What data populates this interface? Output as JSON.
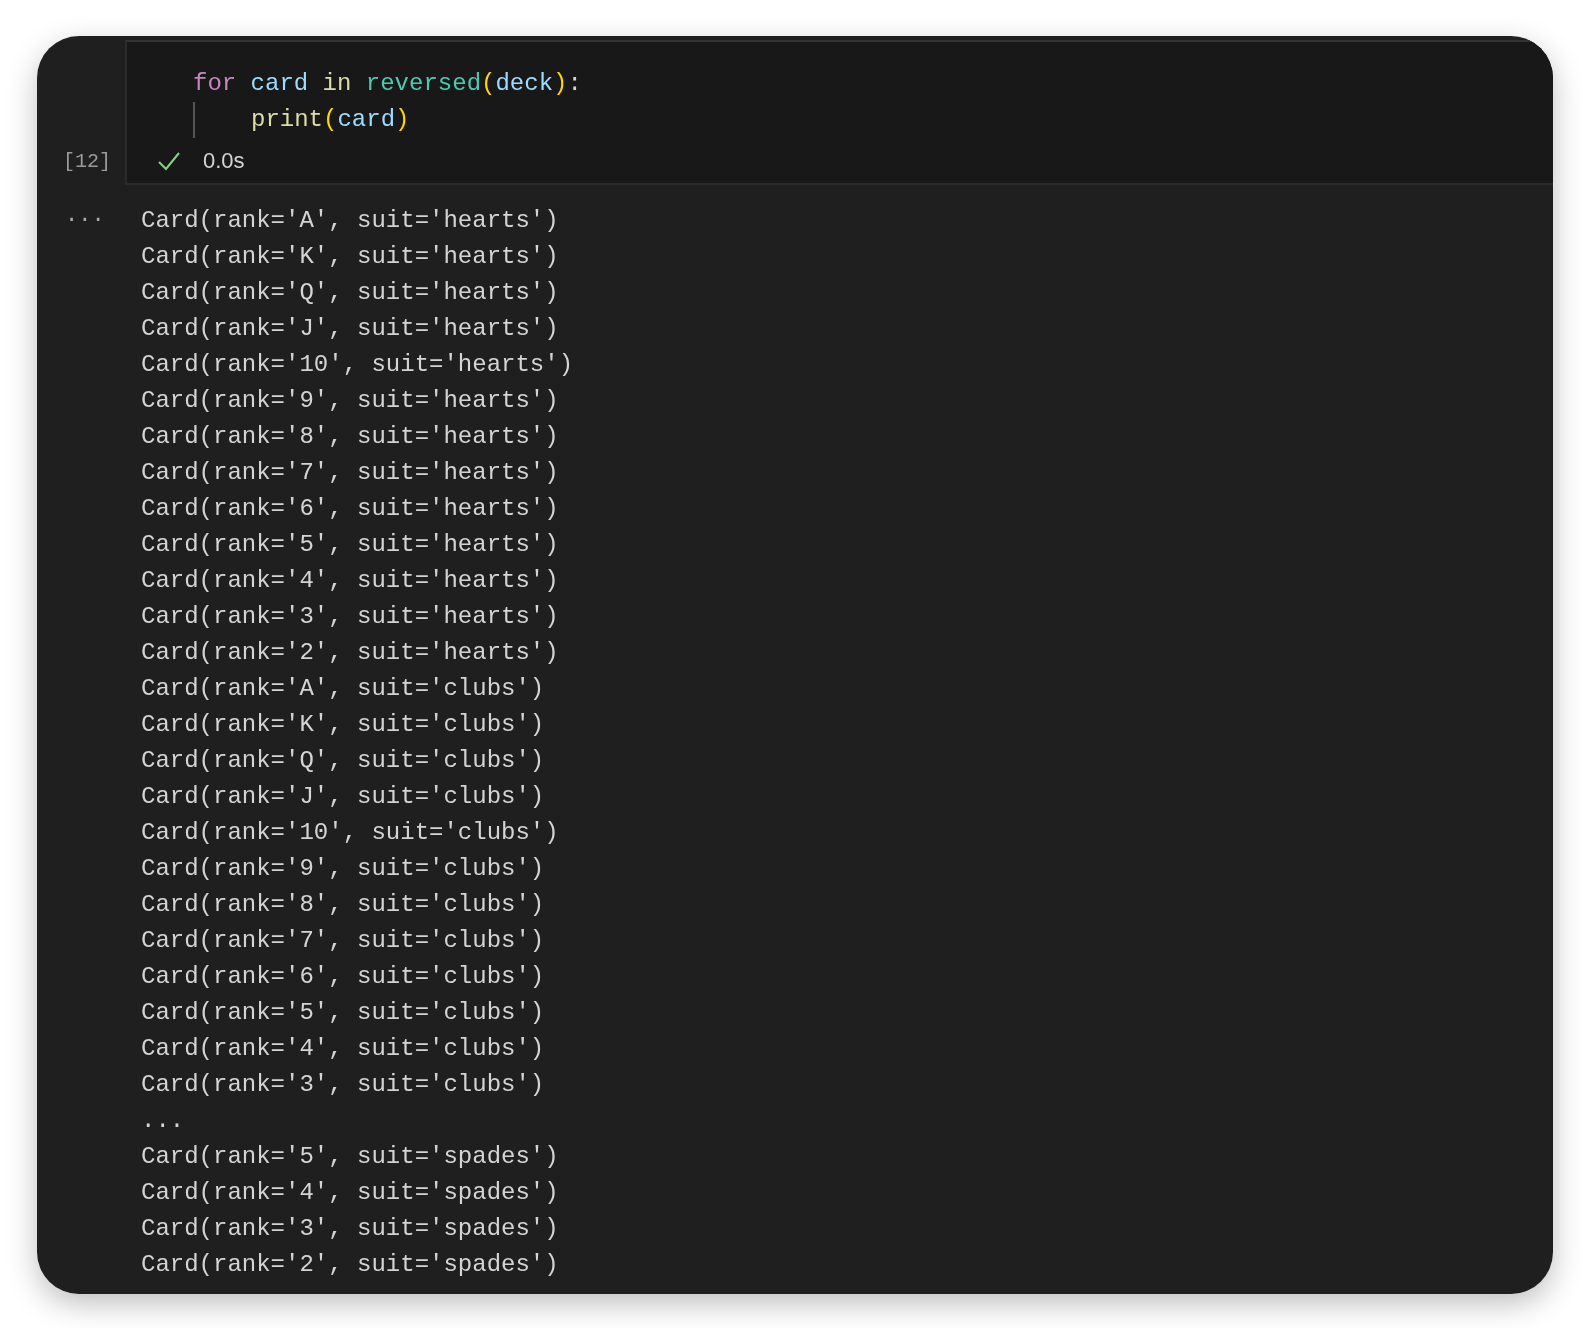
{
  "cell": {
    "code_lines": [
      {
        "kind": "plain",
        "words": [
          [
            {
              "text": "for",
              "kind": "keyword"
            }
          ],
          [
            {
              "text": "card",
              "kind": "variable"
            }
          ],
          [
            {
              "text": "in",
              "kind": "function"
            }
          ],
          [
            {
              "text": "reversed",
              "kind": "class"
            },
            {
              "text": "(",
              "kind": "bracket"
            },
            {
              "text": "deck",
              "kind": "variable"
            },
            {
              "text": ")",
              "kind": "bracket"
            },
            {
              "text": ":",
              "kind": "punctuation"
            }
          ]
        ]
      },
      {
        "kind": "indented",
        "words": [
          [
            {
              "text": "print",
              "kind": "function"
            },
            {
              "text": "(",
              "kind": "bracket"
            },
            {
              "text": "card",
              "kind": "variable"
            },
            {
              "text": ")",
              "kind": "bracket"
            }
          ]
        ]
      }
    ],
    "execution_count": "[12]",
    "succeeded": true,
    "duration": "0.0s"
  },
  "output": {
    "marker": "···",
    "lines": [
      "Card(rank='A', suit='hearts')",
      "Card(rank='K', suit='hearts')",
      "Card(rank='Q', suit='hearts')",
      "Card(rank='J', suit='hearts')",
      "Card(rank='10', suit='hearts')",
      "Card(rank='9', suit='hearts')",
      "Card(rank='8', suit='hearts')",
      "Card(rank='7', suit='hearts')",
      "Card(rank='6', suit='hearts')",
      "Card(rank='5', suit='hearts')",
      "Card(rank='4', suit='hearts')",
      "Card(rank='3', suit='hearts')",
      "Card(rank='2', suit='hearts')",
      "Card(rank='A', suit='clubs')",
      "Card(rank='K', suit='clubs')",
      "Card(rank='Q', suit='clubs')",
      "Card(rank='J', suit='clubs')",
      "Card(rank='10', suit='clubs')",
      "Card(rank='9', suit='clubs')",
      "Card(rank='8', suit='clubs')",
      "Card(rank='7', suit='clubs')",
      "Card(rank='6', suit='clubs')",
      "Card(rank='5', suit='clubs')",
      "Card(rank='4', suit='clubs')",
      "Card(rank='3', suit='clubs')",
      "...",
      "Card(rank='5', suit='spades')",
      "Card(rank='4', suit='spades')",
      "Card(rank='3', suit='spades')",
      "Card(rank='2', suit='spades')"
    ]
  }
}
